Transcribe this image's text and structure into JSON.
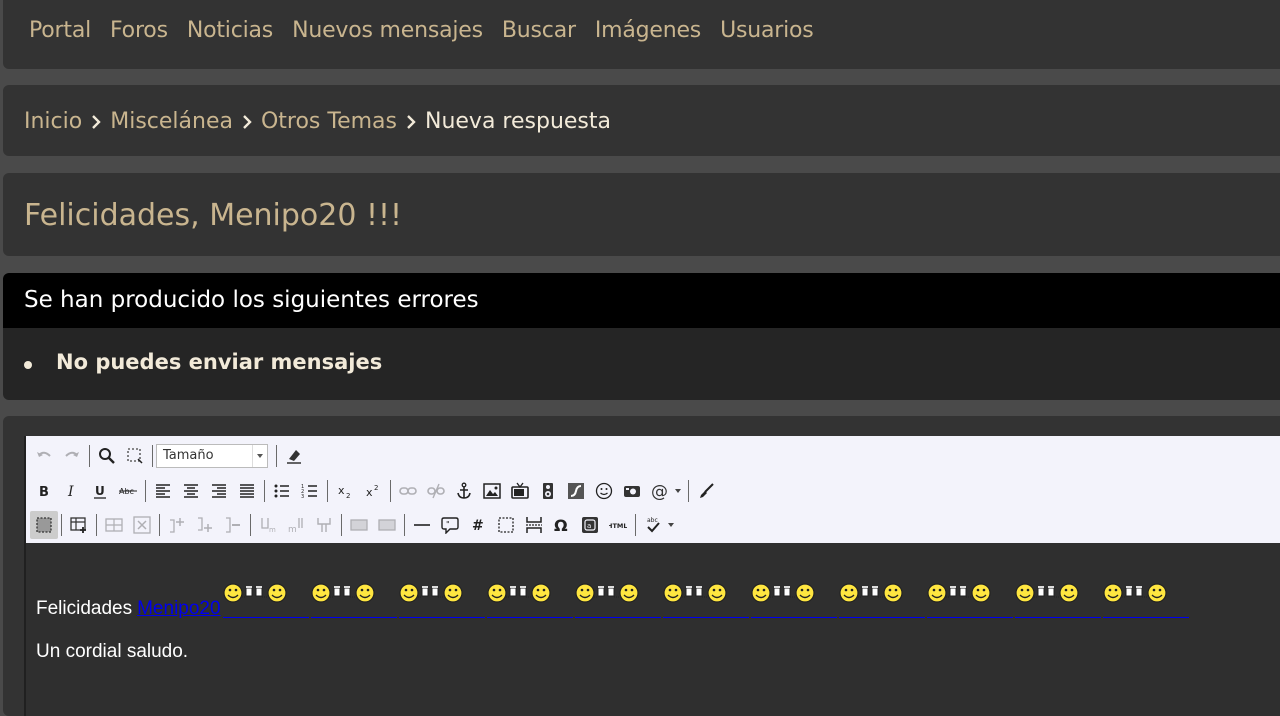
{
  "nav": {
    "items": [
      "Portal",
      "Foros",
      "Noticias",
      "Nuevos mensajes",
      "Buscar",
      "Imágenes",
      "Usuarios"
    ]
  },
  "breadcrumb": {
    "items": [
      "Inicio",
      "Miscelánea",
      "Otros Temas"
    ],
    "current": "Nueva respuesta"
  },
  "page": {
    "title": "Felicidades, Menipo20 !!!"
  },
  "errors": {
    "heading": "Se han producido los siguientes errores",
    "items": [
      "No puedes enviar mensajes"
    ]
  },
  "toolbar": {
    "size_select": "Tamaño",
    "row1_icons": [
      "undo-icon",
      "redo-icon",
      "find-icon",
      "select-all-icon",
      "size-dropdown",
      "remove-format-icon"
    ],
    "row2_icons": [
      "bold-icon",
      "italic-icon",
      "underline-icon",
      "strikethrough-icon",
      "align-left-icon",
      "align-center-icon",
      "align-right-icon",
      "align-justify-icon",
      "bullet-list-icon",
      "numbered-list-icon",
      "subscript-icon",
      "superscript-icon",
      "link-icon",
      "unlink-icon",
      "anchor-icon",
      "image-icon",
      "video-icon",
      "audio-icon",
      "flash-icon",
      "smiley-icon",
      "screenshot-icon",
      "mention-icon",
      "spellcheck-brush-icon"
    ],
    "row3_icons": [
      "show-blocks-icon",
      "table-icon",
      "merge-cells-icon",
      "split-cell-icon",
      "insert-row-before-icon",
      "insert-row-after-icon",
      "delete-row-icon",
      "insert-col-before-icon",
      "insert-col-after-icon",
      "delete-col-icon",
      "insert-before-icon",
      "insert-after-icon",
      "horizontal-rule-icon",
      "quote-icon",
      "hashtag-icon",
      "div-icon",
      "page-break-icon",
      "special-char-icon",
      "code-icon",
      "html-icon",
      "spellcheck-icon"
    ]
  },
  "editor": {
    "line1_text": "Felicidades",
    "mention": "Menipo20",
    "smiley_count": 11,
    "line2": "Un cordial saludo."
  },
  "colors": {
    "accent": "#c9b58f",
    "panel": "#333333",
    "error_head": "#000000",
    "link": "#0000ee"
  }
}
